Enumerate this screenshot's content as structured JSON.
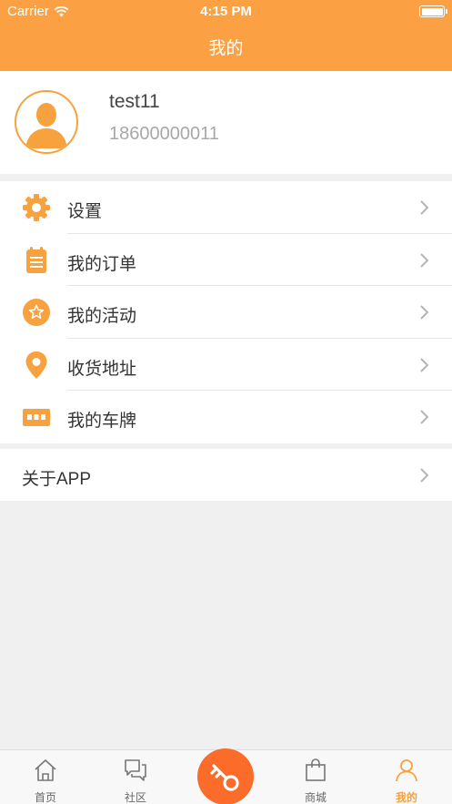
{
  "status_bar": {
    "carrier": "Carrier",
    "time": "4:15 PM",
    "battery_level": 1.0
  },
  "nav": {
    "title": "我的"
  },
  "profile": {
    "username": "test11",
    "phone": "18600000011"
  },
  "menu": [
    {
      "label": "设置",
      "icon": "gear-icon"
    },
    {
      "label": "我的订单",
      "icon": "clipboard-icon"
    },
    {
      "label": "我的活动",
      "icon": "star-badge-icon"
    },
    {
      "label": "收货地址",
      "icon": "location-pin-icon"
    },
    {
      "label": "我的车牌",
      "icon": "license-plate-icon"
    }
  ],
  "about": {
    "label": "关于APP"
  },
  "tabs": [
    {
      "label": "首页",
      "icon": "home-icon",
      "active": false
    },
    {
      "label": "社区",
      "icon": "chat-icon",
      "active": false
    },
    {
      "label": "",
      "icon": "key-icon",
      "active": false
    },
    {
      "label": "商城",
      "icon": "shopping-bag-icon",
      "active": false
    },
    {
      "label": "我的",
      "icon": "person-icon",
      "active": true
    }
  ],
  "colors": {
    "accent": "#fba143",
    "center_button": "#fb6c2a",
    "background": "#f0f0f0"
  }
}
